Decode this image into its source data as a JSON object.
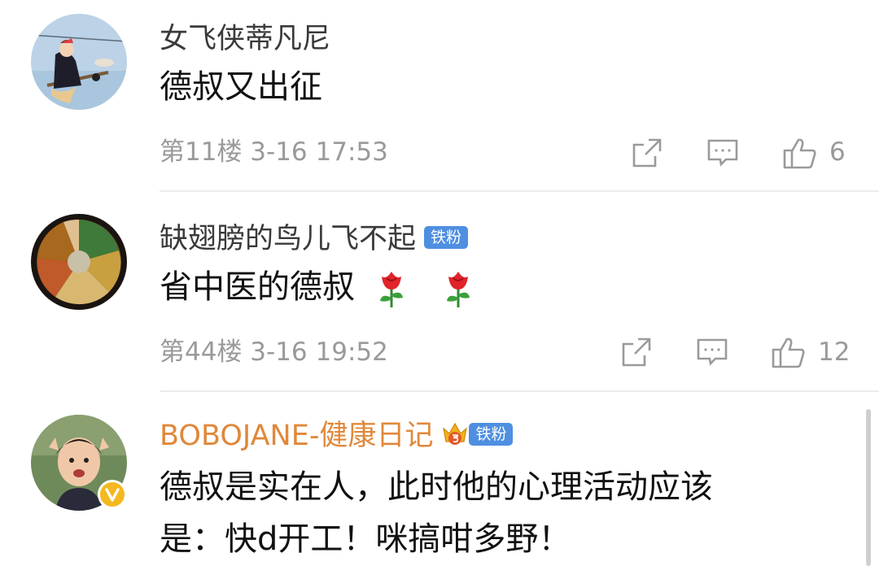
{
  "comments": [
    {
      "username": "女飞侠蒂凡尼",
      "text": "德叔又出征",
      "floor_time": "第11楼 3-16 17:53",
      "likes": "6"
    },
    {
      "username": "缺翅膀的鸟儿飞不起",
      "badge": "铁粉",
      "text": "省中医的德叔",
      "floor_time": "第44楼 3-16 19:52",
      "likes": "12"
    },
    {
      "username": "BOBOJANE-健康日记",
      "badge": "铁粉",
      "text_line1": "德叔是实在人，此时他的心理活动应该",
      "text_line2": "是：快d开工！咪搞咁多野！"
    }
  ],
  "icons": {
    "share": "share-icon",
    "comment": "comment-icon",
    "like": "thumbs-up-icon",
    "rose": "rose-emoji-icon",
    "crown": "crown-icon",
    "verified": "verified-v-icon"
  },
  "colors": {
    "username": "#3a3a3a",
    "username_gold": "#e0883a",
    "meta": "#9a9a9a",
    "badge_bg": "#4f8fe0",
    "divider": "#ececec"
  }
}
